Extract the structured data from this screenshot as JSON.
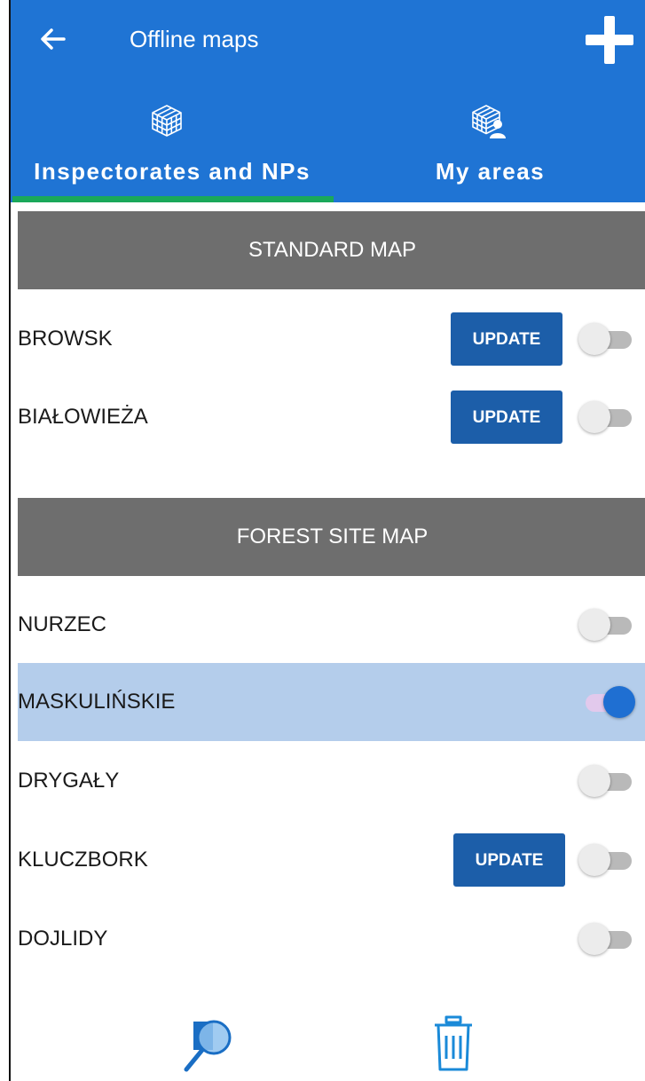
{
  "appbar": {
    "title": "Offline maps",
    "back_icon": "arrow-left-icon",
    "add_icon": "plus-icon",
    "color": "#1f74d4"
  },
  "tabs": [
    {
      "label": "Inspectorates and NPs",
      "icon": "cube-grid-icon",
      "selected": true
    },
    {
      "label": "My areas",
      "icon": "cube-grid-person-icon",
      "selected": false
    }
  ],
  "sections": {
    "standard": {
      "title": "STANDARD MAP",
      "rows": [
        {
          "name": "BROWSK",
          "update_label": "UPDATE",
          "enabled": false
        },
        {
          "name": "BIAŁOWIEŻA",
          "update_label": "UPDATE",
          "enabled": false
        }
      ]
    },
    "forest": {
      "title": "FOREST SITE MAP",
      "rows": [
        {
          "name": "NURZEC",
          "enabled": false
        },
        {
          "name": "MASKULIŃSKIE",
          "enabled": true,
          "selected": true
        },
        {
          "name": "DRYGAŁY",
          "enabled": false
        },
        {
          "name": "KLUCZBORK",
          "update_label": "UPDATE",
          "enabled": false
        },
        {
          "name": "DOJLIDY",
          "enabled": false
        }
      ]
    }
  },
  "bottom_bar": {
    "search_icon": "map-search-icon",
    "delete_icon": "trash-icon"
  },
  "colors": {
    "accent": "#1f74d4",
    "update_button": "#1c5ea9",
    "section_header": "#6e6e6e",
    "selected_row": "#b4cdeb",
    "tab_indicator": "#1aa85a"
  }
}
